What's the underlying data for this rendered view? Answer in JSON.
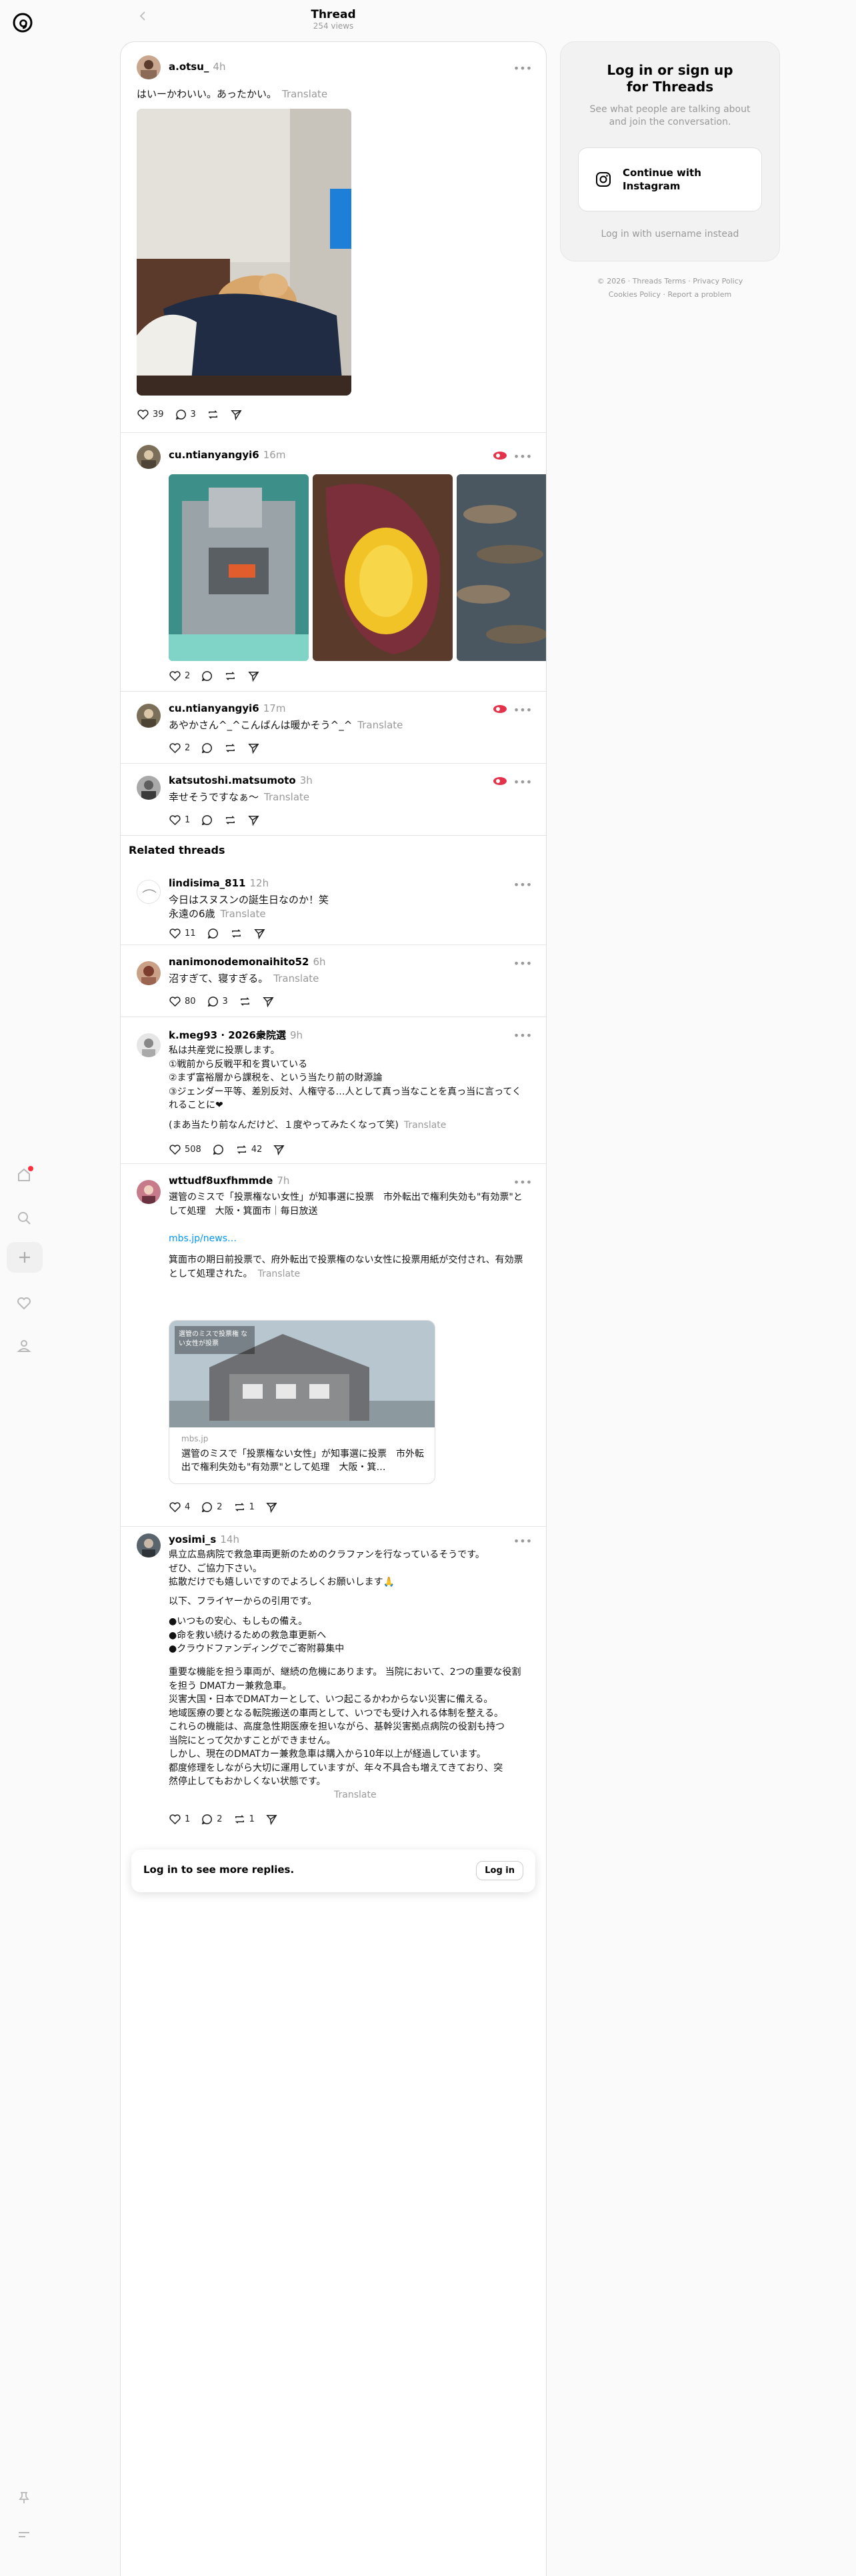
{
  "header": {
    "title": "Thread",
    "views": "254 views"
  },
  "login_panel": {
    "title": "Log in or sign up\nfor Threads",
    "subtitle": "See what people are talking about and join the conversation.",
    "continue_label": "Continue with\nInstagram",
    "alt_login": "Log in with username instead"
  },
  "footer": {
    "line1": "© 2026 · Threads Terms · Privacy Policy",
    "line2": "Cookies Policy · Report a problem"
  },
  "main_post": {
    "username": "a.otsu_",
    "time": "4h",
    "text": "はいーかわいい。あったかい。",
    "translate": "Translate",
    "likes": "39",
    "replies": "3"
  },
  "replies": [
    {
      "username": "cu.ntianyangyi6",
      "time": "16m",
      "likes": "2"
    },
    {
      "username": "cu.ntianyangyi6",
      "time": "17m",
      "text": "あやかさん^_^こんばんは暖かそう^_^",
      "translate": "Translate",
      "likes": "2"
    },
    {
      "username": "katsutoshi.matsumoto",
      "time": "3h",
      "text": "幸せそうですなぁ〜",
      "translate": "Translate",
      "likes": "1"
    }
  ],
  "related_header": "Related threads",
  "related": [
    {
      "username": "lindisima_811",
      "time": "12h",
      "text": "今日はスヌスンの誕生日なのか！笑\n永遠の6歳",
      "translate": "Translate",
      "likes": "11"
    },
    {
      "username": "nanimonodemonaihito52",
      "time": "6h",
      "text": "沼すぎて、寝すぎる。",
      "translate": "Translate",
      "likes": "80",
      "replies": "3"
    },
    {
      "username": "k.meg93",
      "tag": "· 2026衆院選",
      "time": "9h",
      "text": "私は共産党に投票します。\n①戦前から反戦平和を貫いている\n②まず富裕層から課税を、という当たり前の財源論\n③ジェンダー平等、差別反対、人権守る…人として真っ当なことを真っ当に言ってくれることに❤",
      "text2": "(まあ当たり前なんだけど、１度やってみたくなって笑)",
      "translate": "Translate",
      "likes": "508",
      "reposts": "42"
    },
    {
      "username": "wttudf8uxfhmmde",
      "time": "7h",
      "text": "選管のミスで「投票権ない女性」が知事選に投票　市外転出で権利失効も\"有効票\"として処理　大阪・箕面市｜毎日放送",
      "link": "mbs.jp/news…",
      "text2": "箕面市の期日前投票で、府外転出で投票権のない女性に投票用紙が交付され、有効票として処理された。",
      "translate": "Translate",
      "card_source": "mbs.jp",
      "card_title": "選管のミスで「投票権ない女性」が知事選に投票　市外転出で権利失効も\"有効票\"として処理　大阪・箕…",
      "card_overlay": "選管のミスで投票権 ない女性が投票",
      "likes": "4",
      "replies": "2",
      "reposts": "1"
    },
    {
      "username": "yosimi_s",
      "time": "14h",
      "text": "県立広島病院で救急車両更新のためのクラファンを行なっているそうです。\nぜひ、ご協力下さい。\n拡散だけでも嬉しいですのでよろしくお願いします🙏",
      "text2": "以下、フライヤーからの引用です。",
      "text3": "●いつもの安心、もしもの備え。\n●命を救い続けるための救急車更新へ\n●クラウドファンディングでご寄附募集中",
      "text4": "重要な機能を担う車両が、継続の危機にあります。 当院において、2つの重要な役割\nを担う DMATカー兼救急車。\n災害大国・日本でDMATカーとして、いつ起こるかわからない災害に備える。\n地域医療の要となる転院搬送の車両として、いつでも受け入れる体制を整える。\nこれらの機能は、高度急性期医療を担いながら、基幹災害拠点病院の役割も持つ\n当院にとって欠かすことができません。\nしかし、現在のDMATカー兼救急車は購入から10年以上が経過しています。\n都度修理をしながら大切に運用していますが、年々不具合も増えてきており、突\n然停止してもおかしくない状態です。",
      "translate": "Translate",
      "likes": "1",
      "replies": "2",
      "reposts": "1"
    }
  ],
  "login_bar": {
    "text": "Log in to see more replies.",
    "button": "Log in"
  },
  "colors": {
    "accent": "#0095f6",
    "notification": "#ff3040",
    "muted": "#999999"
  }
}
